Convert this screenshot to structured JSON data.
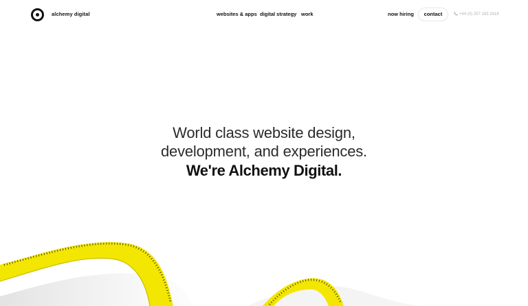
{
  "brand": {
    "name": "alchemy digital",
    "icon": "target-logo-icon"
  },
  "nav": {
    "items": [
      "websites & apps",
      "digital strategy",
      "work"
    ]
  },
  "header_right": {
    "hiring": "now hiring",
    "contact": "contact",
    "phone": "+44 (0) 207 183 2418",
    "phone_icon": "phone-icon"
  },
  "hero": {
    "line1": "World class website design,",
    "line2": "development, and experiences.",
    "line3": "We're Alchemy Digital."
  },
  "colors": {
    "accent": "#f3e600",
    "text": "#111111"
  }
}
